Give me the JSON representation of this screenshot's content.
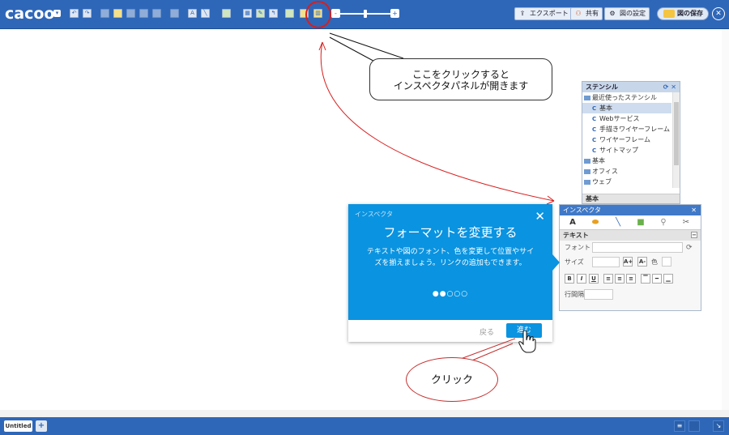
{
  "app": {
    "logo": "cacoo"
  },
  "toolbar": {
    "zoom_minus": "-",
    "zoom_plus": "+",
    "export_label": "エクスポート",
    "share_label": "共有",
    "settings_label": "図の設定",
    "save_label": "図の保存",
    "close_symbol": "✕"
  },
  "annotations": {
    "callout_inspector": "ここをクリックすると\nインスペクタパネルが開きます",
    "callout_click": "クリック"
  },
  "stencil_panel": {
    "title": "ステンシル",
    "items": [
      {
        "label": "最近使ったステンシル",
        "kind": "folder"
      },
      {
        "label": "基本",
        "kind": "stencil",
        "selected": true
      },
      {
        "label": "Webサービス",
        "kind": "stencil"
      },
      {
        "label": "手描きワイヤーフレーム",
        "kind": "stencil"
      },
      {
        "label": "ワイヤーフレーム",
        "kind": "stencil"
      },
      {
        "label": "サイトマップ",
        "kind": "stencil"
      },
      {
        "label": "基本",
        "kind": "folder"
      },
      {
        "label": "オフィス",
        "kind": "folder"
      },
      {
        "label": "ウェブ",
        "kind": "folder"
      }
    ],
    "footer": "基本"
  },
  "inspector": {
    "title": "インスペクタ",
    "section": "テキスト",
    "font_label": "フォント",
    "size_label": "サイズ",
    "color_label": "色",
    "line_height_label": "行間隔",
    "tab_text": "A",
    "format_buttons": [
      "B",
      "I",
      "U"
    ]
  },
  "tutorial": {
    "label": "インスペクタ",
    "title": "フォーマットを変更する",
    "body": "テキストや図のフォント、色を変更して位置やサイズを揃えましょう。リンクの追加もできます。",
    "dots": "●●○○○",
    "back": "戻る",
    "next": "進む",
    "close": "✕",
    "accent": "#0a93e0"
  },
  "bottom": {
    "page_tab": "Untitled",
    "add_page": "+"
  },
  "colors": {
    "toolbar": "#2f67b8",
    "annotation": "#d81e1e"
  }
}
